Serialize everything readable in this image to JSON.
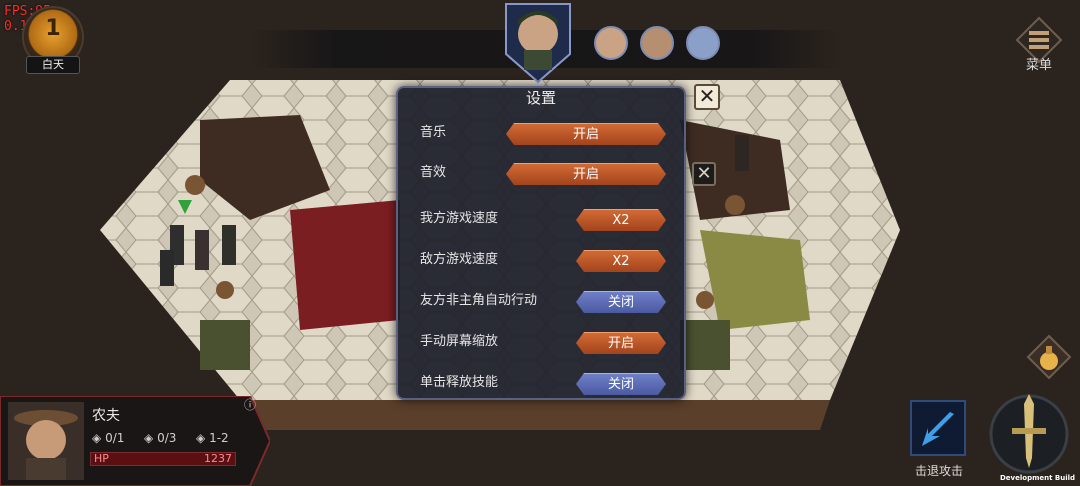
{
  "debug": {
    "fps": "FPS:95",
    "version": "0.1.8"
  },
  "day": {
    "number": "1",
    "label": "白天"
  },
  "menu": {
    "label": "菜单",
    "icon": "menu-icon"
  },
  "settings": {
    "title": "设置",
    "rows": [
      {
        "label": "音乐",
        "value": "开启",
        "state": "on"
      },
      {
        "label": "音效",
        "value": "开启",
        "state": "on"
      },
      {
        "label": "我方游戏速度",
        "value": "X2",
        "state": "on"
      },
      {
        "label": "敌方游戏速度",
        "value": "X2",
        "state": "on"
      },
      {
        "label": "友方非主角自动行动",
        "value": "关闭",
        "state": "off"
      },
      {
        "label": "手动屏幕缩放",
        "value": "开启",
        "state": "on"
      },
      {
        "label": "单击释放技能",
        "value": "关闭",
        "state": "off"
      }
    ]
  },
  "character": {
    "name": "农夫",
    "stats": [
      "0/1",
      "0/3",
      "1-2"
    ],
    "hp_label": "HP",
    "hp_value": "1237"
  },
  "skill": {
    "label": "击退攻击"
  },
  "footer": {
    "build": "Development Build"
  },
  "colors": {
    "on": "#b4532a",
    "off": "#5a69b2",
    "hp": "#5a0f12"
  }
}
